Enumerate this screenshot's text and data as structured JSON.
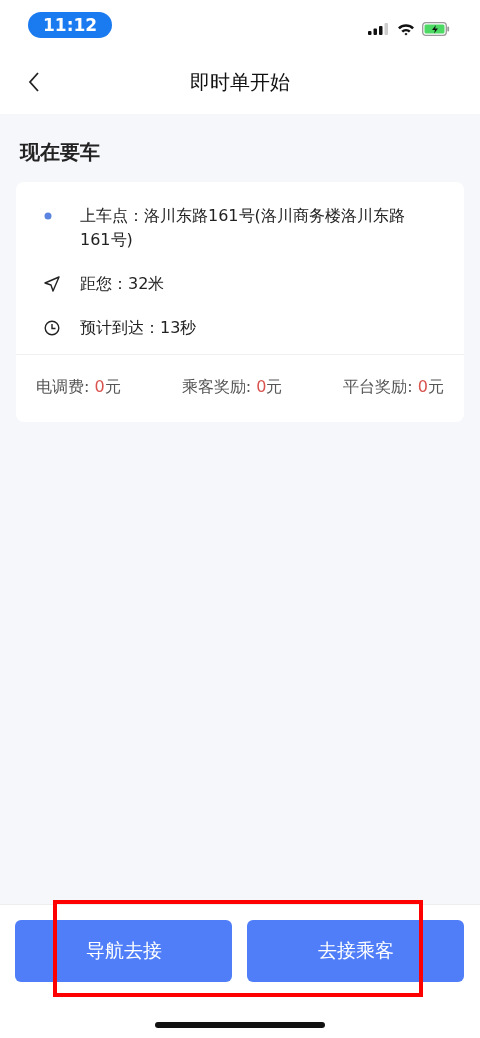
{
  "status_bar": {
    "time": "11:12"
  },
  "nav": {
    "title": "即时单开始"
  },
  "section_title": "现在要车",
  "details": [
    {
      "kind": "pickup",
      "text": "上车点：洛川东路161号(洛川商务楼洛川东路161号)"
    },
    {
      "kind": "distance",
      "text": "距您：32米"
    },
    {
      "kind": "eta",
      "text": "预计到达：13秒"
    }
  ],
  "fees": [
    {
      "label": "电调费: ",
      "amount": "0",
      "unit": "元"
    },
    {
      "label": "乘客奖励: ",
      "amount": "0",
      "unit": "元"
    },
    {
      "label": "平台奖励: ",
      "amount": "0",
      "unit": "元"
    }
  ],
  "buttons": [
    "导航去接",
    "去接乘客"
  ],
  "highlight": {
    "shown": true
  }
}
